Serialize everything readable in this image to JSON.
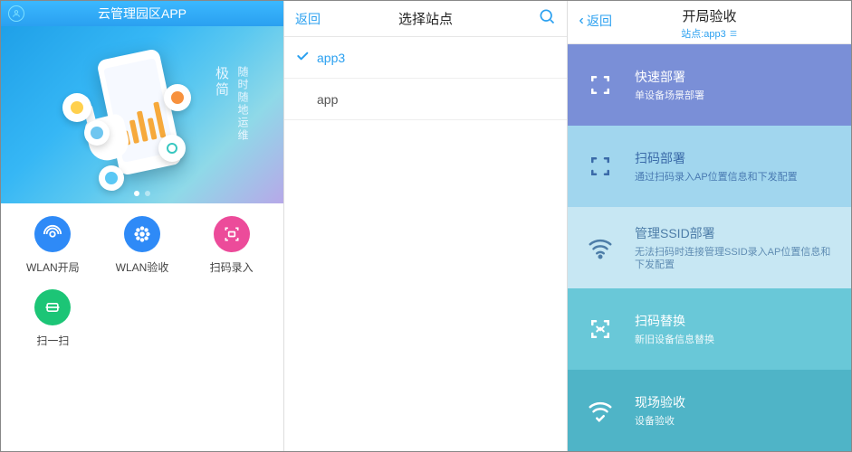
{
  "panel1": {
    "title": "云管理园区APP",
    "hero_text_main": "极简",
    "hero_text_sub": "随时随地运维",
    "features": [
      {
        "label": "WLAN开局"
      },
      {
        "label": "WLAN验收"
      },
      {
        "label": "扫码录入"
      },
      {
        "label": "扫一扫"
      }
    ]
  },
  "panel2": {
    "back": "返回",
    "title": "选择站点",
    "sites": [
      {
        "name": "app3",
        "selected": true
      },
      {
        "name": "app",
        "selected": false
      }
    ]
  },
  "panel3": {
    "back": "返回",
    "title": "开局验收",
    "subtitle": "站点:app3",
    "options": [
      {
        "title": "快速部署",
        "desc": "单设备场景部署"
      },
      {
        "title": "扫码部署",
        "desc": "通过扫码录入AP位置信息和下发配置"
      },
      {
        "title": "管理SSID部署",
        "desc": "无法扫码时连接管理SSID录入AP位置信息和下发配置"
      },
      {
        "title": "扫码替换",
        "desc": "新旧设备信息替换"
      },
      {
        "title": "现场验收",
        "desc": "设备验收"
      }
    ]
  }
}
